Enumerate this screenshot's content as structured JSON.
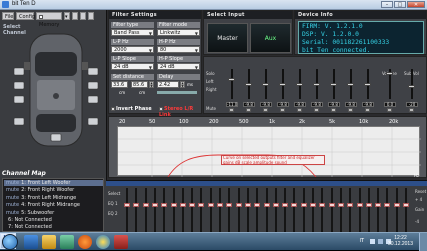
{
  "window": {
    "title": "bit Ten D"
  },
  "menu": {
    "file": "File",
    "config": "Config",
    "memory": "Memory"
  },
  "left": {
    "select_channel_line1": "Select",
    "select_channel_line2": "Channel",
    "channel_map_title": "Channel Map"
  },
  "channel_map": [
    {
      "mute": "mute",
      "num": "1",
      "label": "Front Left Woofer",
      "selected": true
    },
    {
      "mute": "mute",
      "num": "2",
      "label": "Front Right Woofer",
      "selected": false
    },
    {
      "mute": "mute",
      "num": "3",
      "label": "Front Left Midrange",
      "selected": false
    },
    {
      "mute": "mute",
      "num": "4",
      "label": "Front Right Midrange",
      "selected": false
    },
    {
      "mute": "mute",
      "num": "5",
      "label": "Subwoofer",
      "selected": false
    },
    {
      "mute": "",
      "num": "6",
      "label": "Not Connected",
      "selected": false
    },
    {
      "mute": "",
      "num": "7",
      "label": "Not Connected",
      "selected": false
    }
  ],
  "filter": {
    "title": "Filter Settings",
    "filter_type_label": "Filter type",
    "filter_type_value": "Band Pass",
    "filter_mode_label": "Filter mode",
    "filter_mode_value": "Linkwitz",
    "lp_hz_label": "L-P Hz",
    "lp_hz_value": "2000",
    "hp_hz_label": "H-P Hz",
    "hp_hz_value": "80",
    "lp_slope_label": "L-P Slope",
    "lp_slope_value": "24 dB",
    "hp_slope_label": "H-P Slope",
    "hp_slope_value": "24 dB",
    "set_distance_label": "Set distance",
    "distance_a": "33.6",
    "distance_b": "85.6",
    "delay_label": "Delay",
    "delay_value": "2.42",
    "delay_unit": "ms",
    "cm_label": "cm",
    "invert_phase": "Invert Phase",
    "stereo_link": "Stereo L/R Link"
  },
  "select_input": {
    "title": "Select Input",
    "master": "Master",
    "aux": "Aux"
  },
  "device_info": {
    "title": "Device Info",
    "line1": "FIRM: V. 1.2.1.0",
    "line2": "DSP: V. 1.2.0.0",
    "line3": "Serial: 001182261100333",
    "line4": "bit Ten connected."
  },
  "mixer": {
    "solo": "Solo",
    "left": "Left",
    "right": "Right",
    "mute": "Mute",
    "volume": "Volume",
    "sub_vol": "Sub Vol",
    "values": [
      "-11.0",
      "-9.8",
      "-9.8",
      "-9.8",
      "-9.8",
      "-9.8",
      "-9.8",
      "-9.8",
      "-9.8",
      "0.0",
      "-20"
    ],
    "levels": [
      0.65,
      0.5,
      0.5,
      0.5,
      0.5,
      0.5,
      0.5,
      0.5,
      0.5,
      0.9,
      0.4
    ]
  },
  "graph": {
    "freq_ticks": [
      "20",
      "50",
      "100",
      "200",
      "500",
      "1k",
      "2k",
      "5k",
      "10k",
      "20k"
    ],
    "unit": "Hz",
    "note": "Curve on selected outputs filter and equalizer gains dB scale amplitude sound"
  },
  "eq": {
    "select": "Select",
    "gain": "Gain",
    "q_eq": "Q EQ",
    "left_labels": [
      "Select",
      "EQ 1",
      "EQ 2"
    ],
    "right_labels": [
      "Reset",
      "+ 4",
      "Gain",
      "-4"
    ],
    "bands": 31
  },
  "taskbar": {
    "bit_label": "bit",
    "bit_sub": "TEN",
    "lang": "IT",
    "time": "12:22",
    "date": "30.12.2013"
  },
  "colors": {
    "accent_red": "#ff3a3a",
    "device_text": "#36d2e6",
    "aux_green": "#6dff8a",
    "eq_blue": "#2d4f8a"
  }
}
